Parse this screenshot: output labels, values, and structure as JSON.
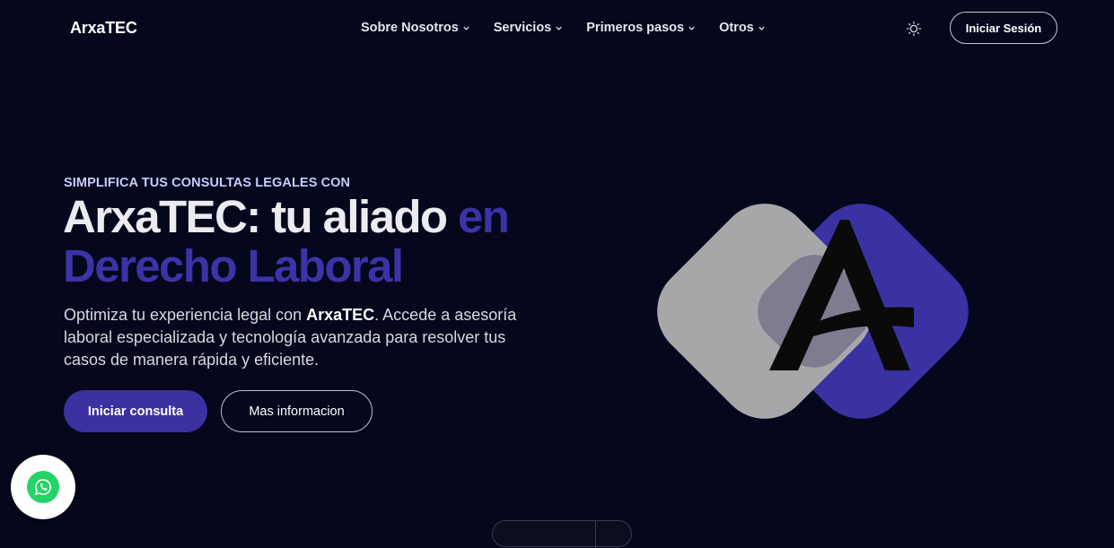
{
  "nav": {
    "logo": "ArxaTEC",
    "items": [
      {
        "label": "Sobre Nosotros"
      },
      {
        "label": "Servicios"
      },
      {
        "label": "Primeros pasos"
      },
      {
        "label": "Otros"
      }
    ],
    "theme_icon": "sun-icon",
    "login_label": "Iniciar Sesión"
  },
  "hero": {
    "eyebrow": "SIMPLIFICA TUS CONSULTAS LEGALES CON",
    "title_white": "ArxaTEC: tu aliado ",
    "title_purple_1": "en",
    "title_purple_2": "Derecho Laboral",
    "desc_1": "Optimiza tu experiencia legal con ",
    "desc_brand": "ArxaTEC",
    "desc_2": ". Accede a asesoría laboral especializada y tecnología avanzada para resolver tus casos de manera rápida y eficiente.",
    "primary_button": "Iniciar consulta",
    "secondary_button": "Mas informacion"
  },
  "colors": {
    "background": "#05071c",
    "accent": "#3b31a0",
    "accent_text": "#3b33a6",
    "eyebrow": "#c6cdfa",
    "whatsapp": "#25d366"
  },
  "icons": {
    "chevron": "chevron-down-icon",
    "whatsapp": "whatsapp-icon"
  }
}
